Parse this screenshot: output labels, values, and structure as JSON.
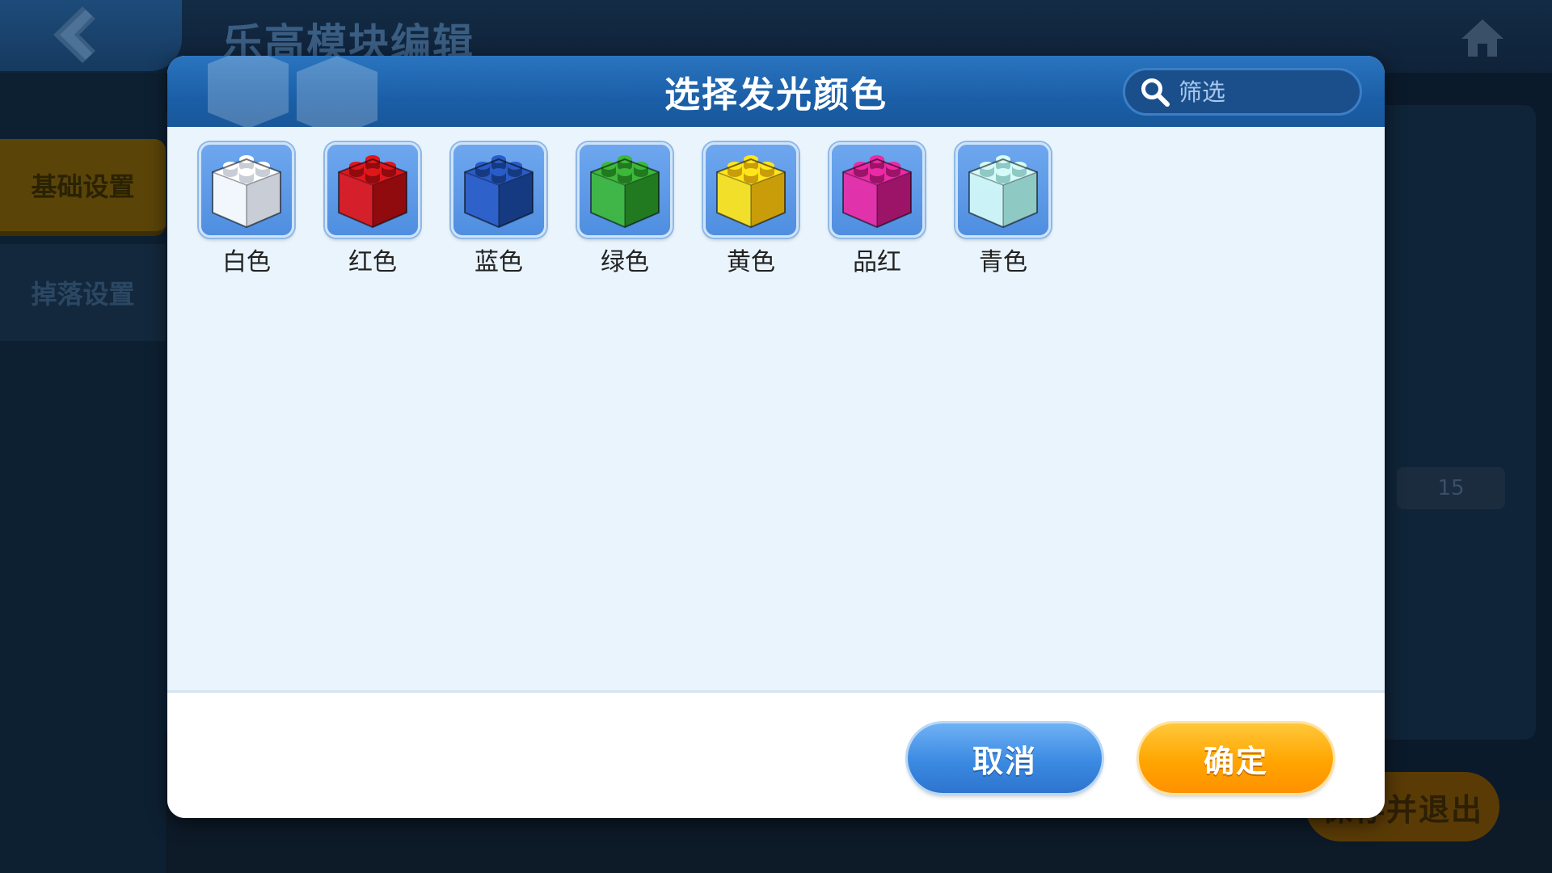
{
  "background": {
    "title": "乐高模块编辑",
    "sidebar_tabs": [
      {
        "label": "基础设置",
        "active": true
      },
      {
        "label": "掉落设置",
        "active": false
      }
    ],
    "value_field": "15",
    "save_button": "保存并退出",
    "icons": {
      "back": "back-arrow-icon",
      "home": "home-icon"
    }
  },
  "dialog": {
    "title": "选择发光颜色",
    "search": {
      "placeholder": "筛选",
      "value": "",
      "icon": "search-icon"
    },
    "colors": [
      {
        "label": "白色",
        "color": "#ffffff",
        "shade": "#c9ced6"
      },
      {
        "label": "红色",
        "color": "#e0161b",
        "shade": "#8f0b0e"
      },
      {
        "label": "蓝色",
        "color": "#2a5cc7",
        "shade": "#163a82"
      },
      {
        "label": "绿色",
        "color": "#3db83a",
        "shade": "#217a20"
      },
      {
        "label": "黄色",
        "color": "#ffe51a",
        "shade": "#c99d0a"
      },
      {
        "label": "品红",
        "color": "#ec2aa6",
        "shade": "#9c1468"
      },
      {
        "label": "青色",
        "color": "#d5fbf8",
        "shade": "#8fc9c4"
      }
    ],
    "buttons": {
      "cancel": "取消",
      "confirm": "确定"
    },
    "button_colors": {
      "cancel": "#3b8ae2",
      "confirm": "#ffa500"
    }
  }
}
